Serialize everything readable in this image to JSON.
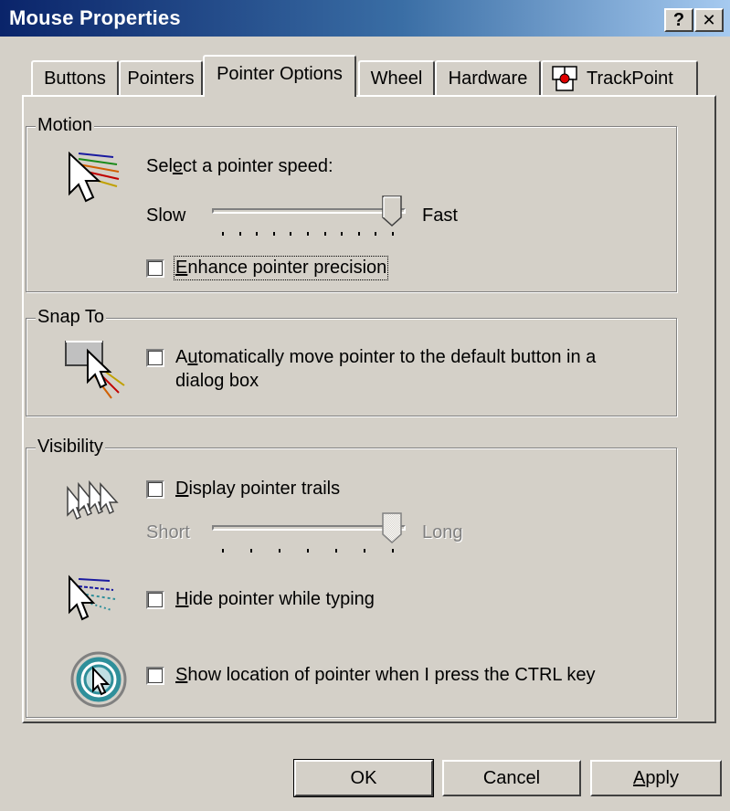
{
  "window": {
    "title": "Mouse Properties",
    "help_glyph": "?",
    "close_glyph": "✕"
  },
  "tabs": [
    {
      "label": "Buttons"
    },
    {
      "label": "Pointers"
    },
    {
      "label": "Pointer Options",
      "active": true
    },
    {
      "label": "Wheel"
    },
    {
      "label": "Hardware"
    },
    {
      "label": "TrackPoint"
    }
  ],
  "motion": {
    "group_label": "Motion",
    "speed_label_pre": "Sel",
    "speed_label_access": "e",
    "speed_label_post": "ct a pointer speed:",
    "slow_label": "Slow",
    "fast_label": "Fast",
    "speed_value_fraction": 1.0,
    "precision_access": "E",
    "precision_rest": "nhance pointer precision",
    "precision_checked": false
  },
  "snap": {
    "group_label": "Snap To",
    "auto_pre": "A",
    "auto_access": "u",
    "auto_post": "tomatically move pointer to the default button in a",
    "auto_line2": "dialog box",
    "auto_checked": false
  },
  "visibility": {
    "group_label": "Visibility",
    "trails_access": "D",
    "trails_rest": "isplay pointer trails",
    "trails_checked": false,
    "short_label": "Short",
    "long_label": "Long",
    "trail_value_fraction": 1.0,
    "hide_access": "H",
    "hide_rest": "ide pointer while typing",
    "hide_checked": false,
    "show_access": "S",
    "show_rest": "how location of pointer when I press the CTRL key",
    "show_checked": false
  },
  "buttons": {
    "ok": "OK",
    "cancel": "Cancel",
    "apply_access": "A",
    "apply_rest": "pply"
  },
  "colors": {
    "title_gradient_start": "#0a246a",
    "title_gradient_end": "#a6caf0",
    "face": "#d4d0c8",
    "trackpoint_red": "#e00000",
    "locate_teal": "#2f8f9a"
  }
}
